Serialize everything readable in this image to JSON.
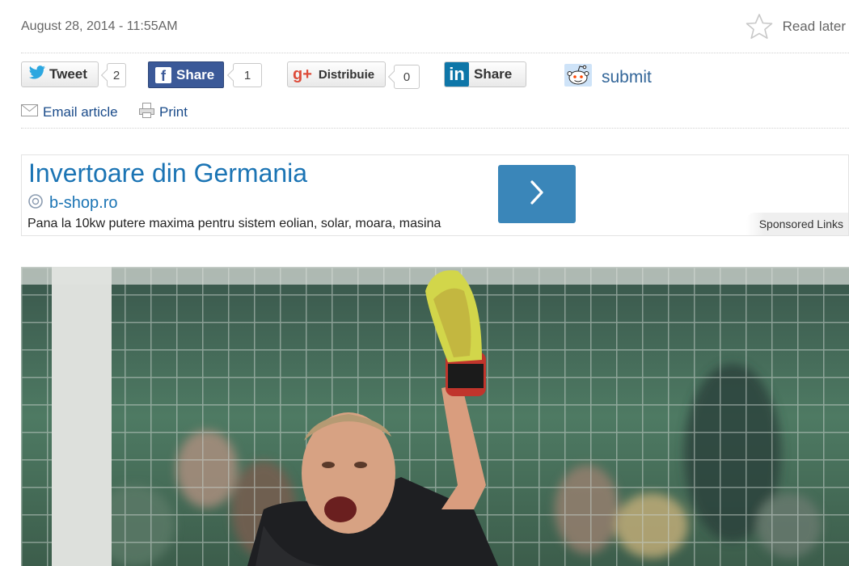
{
  "article": {
    "date": "August 28, 2014 - 11:55AM",
    "read_later": "Read later"
  },
  "share": {
    "tweet_label": "Tweet",
    "tweet_count": "2",
    "facebook_label": "Share",
    "facebook_count": "1",
    "googleplus_label": "Distribuie",
    "googleplus_count": "0",
    "linkedin_label": "Share",
    "reddit_label": "submit"
  },
  "tools": {
    "email_label": "Email article",
    "print_label": "Print"
  },
  "ad": {
    "title": "Invertoare din Germania",
    "url": "b-shop.ro",
    "description": "Pana la 10kw putere maxima pentru sistem eolian, solar, moara, masina",
    "sponsored": "Sponsored Links"
  },
  "icons": [
    "star-icon",
    "twitter-bird-icon",
    "facebook-f-icon",
    "google-plus-icon",
    "linkedin-icon",
    "reddit-alien-icon",
    "envelope-icon",
    "printer-icon",
    "globe-icon",
    "chevron-right-icon"
  ],
  "colors": {
    "link": "#1b74b4",
    "facebook": "#3b5998",
    "linkedin": "#0e76a8",
    "google": "#dd4b39",
    "ad_button": "#3a86b9"
  }
}
